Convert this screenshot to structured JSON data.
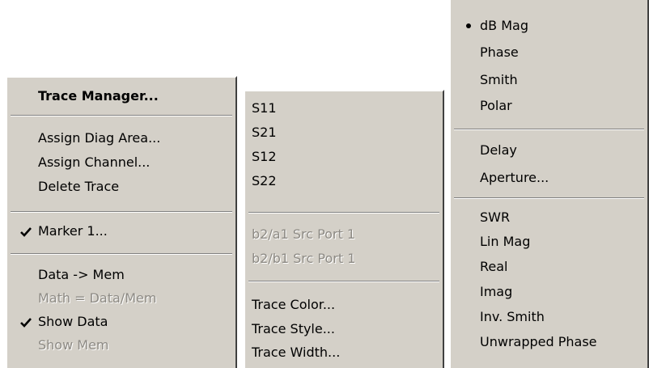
{
  "trace_menu": {
    "items": [
      {
        "label": "Trace Manager..."
      },
      {
        "label": "Assign Diag Area..."
      },
      {
        "label": "Assign Channel..."
      },
      {
        "label": "Delete Trace"
      },
      {
        "label": "Marker 1...",
        "checked": true
      },
      {
        "label": "Data -> Mem"
      },
      {
        "label": "Math = Data/Mem",
        "disabled": true
      },
      {
        "label": "Show Data",
        "checked": true
      },
      {
        "label": "Show Mem",
        "disabled": true
      }
    ]
  },
  "measure_menu": {
    "items": [
      {
        "label": "S11"
      },
      {
        "label": "S21"
      },
      {
        "label": "S12"
      },
      {
        "label": "S22"
      },
      {
        "label": "b2/a1 Src Port 1",
        "disabled": true
      },
      {
        "label": "b2/b1 Src Port 1",
        "disabled": true
      },
      {
        "label": "Trace Color..."
      },
      {
        "label": "Trace Style..."
      },
      {
        "label": "Trace Width..."
      }
    ]
  },
  "format_menu": {
    "items": [
      {
        "label": "dB Mag",
        "selected": true
      },
      {
        "label": "Phase"
      },
      {
        "label": "Smith"
      },
      {
        "label": "Polar"
      },
      {
        "label": "Delay"
      },
      {
        "label": "Aperture..."
      },
      {
        "label": "SWR"
      },
      {
        "label": "Lin Mag"
      },
      {
        "label": "Real"
      },
      {
        "label": "Imag"
      },
      {
        "label": "Inv. Smith"
      },
      {
        "label": "Unwrapped Phase"
      }
    ]
  },
  "icons": {
    "check": "check-icon",
    "radio": "radio-bullet-icon"
  }
}
